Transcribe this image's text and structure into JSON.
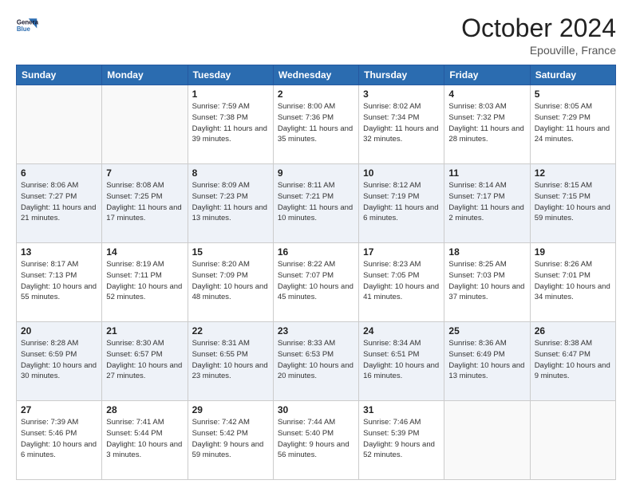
{
  "header": {
    "logo_line1": "General",
    "logo_line2": "Blue",
    "month": "October 2024",
    "location": "Epouville, France"
  },
  "weekdays": [
    "Sunday",
    "Monday",
    "Tuesday",
    "Wednesday",
    "Thursday",
    "Friday",
    "Saturday"
  ],
  "weeks": [
    [
      {
        "day": "",
        "info": ""
      },
      {
        "day": "",
        "info": ""
      },
      {
        "day": "1",
        "info": "Sunrise: 7:59 AM\nSunset: 7:38 PM\nDaylight: 11 hours\nand 39 minutes."
      },
      {
        "day": "2",
        "info": "Sunrise: 8:00 AM\nSunset: 7:36 PM\nDaylight: 11 hours\nand 35 minutes."
      },
      {
        "day": "3",
        "info": "Sunrise: 8:02 AM\nSunset: 7:34 PM\nDaylight: 11 hours\nand 32 minutes."
      },
      {
        "day": "4",
        "info": "Sunrise: 8:03 AM\nSunset: 7:32 PM\nDaylight: 11 hours\nand 28 minutes."
      },
      {
        "day": "5",
        "info": "Sunrise: 8:05 AM\nSunset: 7:29 PM\nDaylight: 11 hours\nand 24 minutes."
      }
    ],
    [
      {
        "day": "6",
        "info": "Sunrise: 8:06 AM\nSunset: 7:27 PM\nDaylight: 11 hours\nand 21 minutes."
      },
      {
        "day": "7",
        "info": "Sunrise: 8:08 AM\nSunset: 7:25 PM\nDaylight: 11 hours\nand 17 minutes."
      },
      {
        "day": "8",
        "info": "Sunrise: 8:09 AM\nSunset: 7:23 PM\nDaylight: 11 hours\nand 13 minutes."
      },
      {
        "day": "9",
        "info": "Sunrise: 8:11 AM\nSunset: 7:21 PM\nDaylight: 11 hours\nand 10 minutes."
      },
      {
        "day": "10",
        "info": "Sunrise: 8:12 AM\nSunset: 7:19 PM\nDaylight: 11 hours\nand 6 minutes."
      },
      {
        "day": "11",
        "info": "Sunrise: 8:14 AM\nSunset: 7:17 PM\nDaylight: 11 hours\nand 2 minutes."
      },
      {
        "day": "12",
        "info": "Sunrise: 8:15 AM\nSunset: 7:15 PM\nDaylight: 10 hours\nand 59 minutes."
      }
    ],
    [
      {
        "day": "13",
        "info": "Sunrise: 8:17 AM\nSunset: 7:13 PM\nDaylight: 10 hours\nand 55 minutes."
      },
      {
        "day": "14",
        "info": "Sunrise: 8:19 AM\nSunset: 7:11 PM\nDaylight: 10 hours\nand 52 minutes."
      },
      {
        "day": "15",
        "info": "Sunrise: 8:20 AM\nSunset: 7:09 PM\nDaylight: 10 hours\nand 48 minutes."
      },
      {
        "day": "16",
        "info": "Sunrise: 8:22 AM\nSunset: 7:07 PM\nDaylight: 10 hours\nand 45 minutes."
      },
      {
        "day": "17",
        "info": "Sunrise: 8:23 AM\nSunset: 7:05 PM\nDaylight: 10 hours\nand 41 minutes."
      },
      {
        "day": "18",
        "info": "Sunrise: 8:25 AM\nSunset: 7:03 PM\nDaylight: 10 hours\nand 37 minutes."
      },
      {
        "day": "19",
        "info": "Sunrise: 8:26 AM\nSunset: 7:01 PM\nDaylight: 10 hours\nand 34 minutes."
      }
    ],
    [
      {
        "day": "20",
        "info": "Sunrise: 8:28 AM\nSunset: 6:59 PM\nDaylight: 10 hours\nand 30 minutes."
      },
      {
        "day": "21",
        "info": "Sunrise: 8:30 AM\nSunset: 6:57 PM\nDaylight: 10 hours\nand 27 minutes."
      },
      {
        "day": "22",
        "info": "Sunrise: 8:31 AM\nSunset: 6:55 PM\nDaylight: 10 hours\nand 23 minutes."
      },
      {
        "day": "23",
        "info": "Sunrise: 8:33 AM\nSunset: 6:53 PM\nDaylight: 10 hours\nand 20 minutes."
      },
      {
        "day": "24",
        "info": "Sunrise: 8:34 AM\nSunset: 6:51 PM\nDaylight: 10 hours\nand 16 minutes."
      },
      {
        "day": "25",
        "info": "Sunrise: 8:36 AM\nSunset: 6:49 PM\nDaylight: 10 hours\nand 13 minutes."
      },
      {
        "day": "26",
        "info": "Sunrise: 8:38 AM\nSunset: 6:47 PM\nDaylight: 10 hours\nand 9 minutes."
      }
    ],
    [
      {
        "day": "27",
        "info": "Sunrise: 7:39 AM\nSunset: 5:46 PM\nDaylight: 10 hours\nand 6 minutes."
      },
      {
        "day": "28",
        "info": "Sunrise: 7:41 AM\nSunset: 5:44 PM\nDaylight: 10 hours\nand 3 minutes."
      },
      {
        "day": "29",
        "info": "Sunrise: 7:42 AM\nSunset: 5:42 PM\nDaylight: 9 hours\nand 59 minutes."
      },
      {
        "day": "30",
        "info": "Sunrise: 7:44 AM\nSunset: 5:40 PM\nDaylight: 9 hours\nand 56 minutes."
      },
      {
        "day": "31",
        "info": "Sunrise: 7:46 AM\nSunset: 5:39 PM\nDaylight: 9 hours\nand 52 minutes."
      },
      {
        "day": "",
        "info": ""
      },
      {
        "day": "",
        "info": ""
      }
    ]
  ]
}
